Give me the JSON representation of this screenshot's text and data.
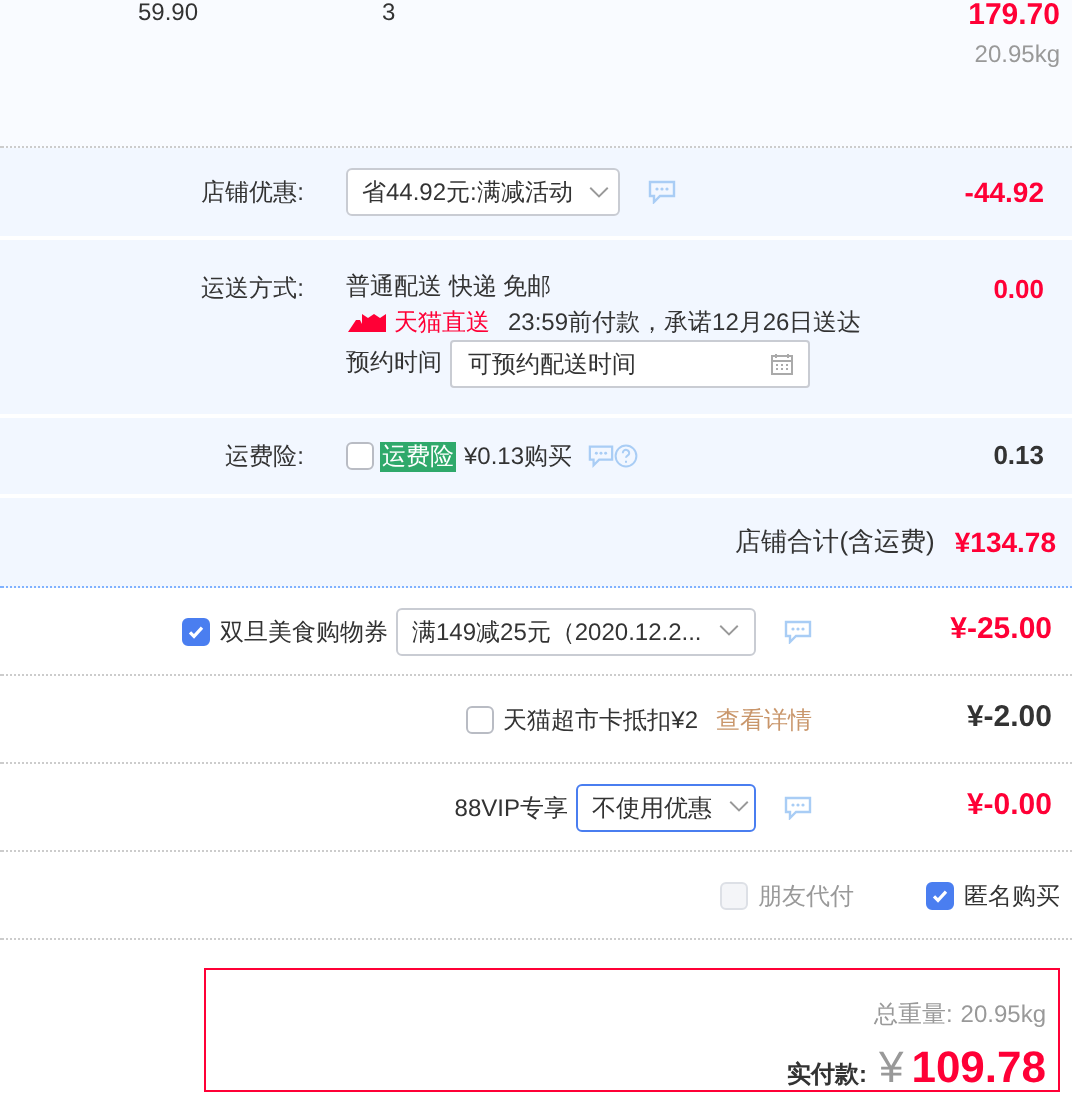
{
  "item_row": {
    "price": "59.90",
    "quantity": "3",
    "subtotal": "179.70",
    "weight": "20.95kg"
  },
  "store_discount": {
    "label": "店铺优惠:",
    "select": "省44.92元:满减活动",
    "amount": "-44.92"
  },
  "shipping": {
    "label": "运送方式:",
    "method": "普通配送 快递 免邮",
    "badge": "天猫直送",
    "promise": "23:59前付款，承诺12月26日送达",
    "schedule_label": "预约时间",
    "schedule_placeholder": "可预约配送时间",
    "amount": "0.00"
  },
  "insurance": {
    "label": "运费险:",
    "checked": false,
    "tag": "运费险",
    "price": "¥0.13购买",
    "amount": "0.13"
  },
  "store_total": {
    "label": "店铺合计(含运费)",
    "amount": "¥134.78"
  },
  "discounts": [
    {
      "kind": "coupon",
      "checked": true,
      "label": "双旦美食购物券",
      "select": "满149减25元（2020.12.2...",
      "amount": "¥-25.00",
      "amount_muted": false
    },
    {
      "kind": "card",
      "checked": false,
      "label": "天猫超市卡抵扣¥2",
      "link": "查看详情",
      "amount": "¥-2.00",
      "amount_muted": true
    },
    {
      "kind": "vip",
      "label": "88VIP专享",
      "select": "不使用优惠",
      "amount": "¥-0.00",
      "amount_muted": false
    }
  ],
  "options": [
    {
      "label": "朋友代付",
      "checked": false,
      "disabled": true
    },
    {
      "label": "匿名购买",
      "checked": true,
      "disabled": false
    }
  ],
  "total": {
    "weight_label": "总重量:",
    "weight": "20.95kg",
    "pay_label": "实付款:",
    "currency": "¥",
    "amount": "109.78"
  }
}
